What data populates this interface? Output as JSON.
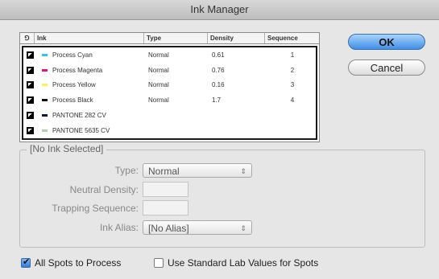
{
  "window": {
    "title": "Ink Manager"
  },
  "table": {
    "headers": {
      "alias_icon": "⅁",
      "ink": "Ink",
      "type": "Type",
      "density": "Density",
      "sequence": "Sequence"
    },
    "rows": [
      {
        "ink": "Process Cyan",
        "color": "#2ec6f0",
        "type": "Normal",
        "density": "0.61",
        "sequence": "1"
      },
      {
        "ink": "Process Magenta",
        "color": "#e6127e",
        "type": "Normal",
        "density": "0.76",
        "sequence": "2"
      },
      {
        "ink": "Process Yellow",
        "color": "#fff04a",
        "type": "Normal",
        "density": "0.16",
        "sequence": "3"
      },
      {
        "ink": "Process Black",
        "color": "#111111",
        "type": "Normal",
        "density": "1.7",
        "sequence": "4"
      },
      {
        "ink": "PANTONE 282 CV",
        "color": "#0a1a40",
        "type": "",
        "density": "",
        "sequence": ""
      },
      {
        "ink": "PANTONE 5635 CV",
        "color": "#b8ccb8",
        "type": "",
        "density": "",
        "sequence": ""
      }
    ]
  },
  "buttons": {
    "ok": "OK",
    "cancel": "Cancel"
  },
  "details": {
    "group_title": "[No Ink Selected]",
    "type_label": "Type:",
    "type_value": "Normal",
    "neutral_density_label": "Neutral Density:",
    "trapping_sequence_label": "Trapping Sequence:",
    "ink_alias_label": "Ink Alias:",
    "ink_alias_value": "[No Alias]",
    "stepper_arrows": "⇕"
  },
  "options": {
    "all_spots_label": "All Spots to Process",
    "all_spots_checked": true,
    "lab_values_label": "Use Standard Lab Values for Spots",
    "lab_values_checked": false
  },
  "colors": {
    "ok_button": "#3f8fe6",
    "selection_border": "#1a1a1a"
  }
}
